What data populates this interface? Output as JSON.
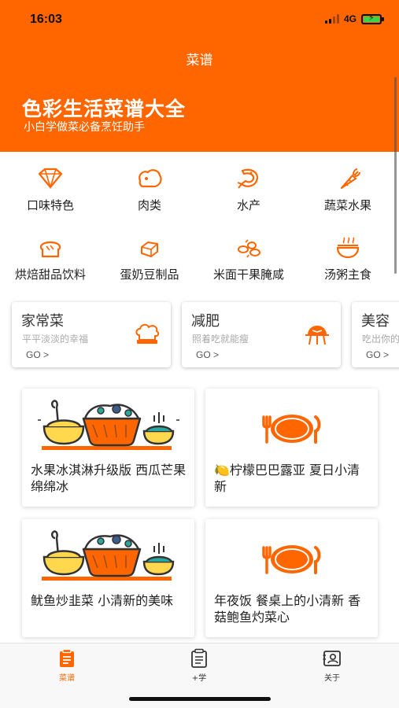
{
  "status_bar": {
    "time": "16:03",
    "network": "4G"
  },
  "nav": {
    "title": "菜谱"
  },
  "banner": {
    "title": "色彩生活菜谱大全",
    "subtitle": "小白学做菜必备烹饪助手"
  },
  "theme": {
    "accent": "#FF6600",
    "text": "#222222",
    "muted": "#AAAAAA"
  },
  "categories": [
    {
      "label": "口味特色",
      "icon": "diamond-icon"
    },
    {
      "label": "肉类",
      "icon": "meat-icon"
    },
    {
      "label": "水产",
      "icon": "shrimp-icon"
    },
    {
      "label": "蔬菜水果",
      "icon": "carrot-icon"
    },
    {
      "label": "烘焙甜品饮料",
      "icon": "bread-icon"
    },
    {
      "label": "蛋奶豆制品",
      "icon": "tofu-icon"
    },
    {
      "label": "米面干果腌咸",
      "icon": "grain-icon"
    },
    {
      "label": "汤粥主食",
      "icon": "soup-bowl-icon"
    }
  ],
  "scenes": [
    {
      "title": "家常菜",
      "subtitle": "平平淡淡的幸福",
      "go": "GO >",
      "icon": "chef-hat-icon"
    },
    {
      "title": "减肥",
      "subtitle": "照着吃就能瘦",
      "go": "GO >",
      "icon": "scale-icon"
    },
    {
      "title": "美容",
      "subtitle": "吃出你的",
      "go": "GO >",
      "icon": "beauty-icon"
    }
  ],
  "recipes": [
    {
      "title": "水果冰淇淋升级版 西瓜芒果绵绵冰",
      "image": "food-spread-illustration"
    },
    {
      "title": "🍋柠檬巴巴露亚  夏日小清新",
      "image": "plate-cutlery-illustration"
    },
    {
      "title": "鱿鱼炒韭菜 小清新的美味",
      "image": "food-spread-illustration"
    },
    {
      "title": "年夜饭 餐桌上的小清新 香菇鲍鱼灼菜心",
      "image": "plate-cutlery-illustration"
    }
  ],
  "tabs": [
    {
      "label": "菜谱",
      "icon": "recipe-book-icon",
      "active": true
    },
    {
      "label": "+学",
      "icon": "clipboard-icon",
      "active": false
    },
    {
      "label": "关于",
      "icon": "profile-card-icon",
      "active": false
    }
  ]
}
